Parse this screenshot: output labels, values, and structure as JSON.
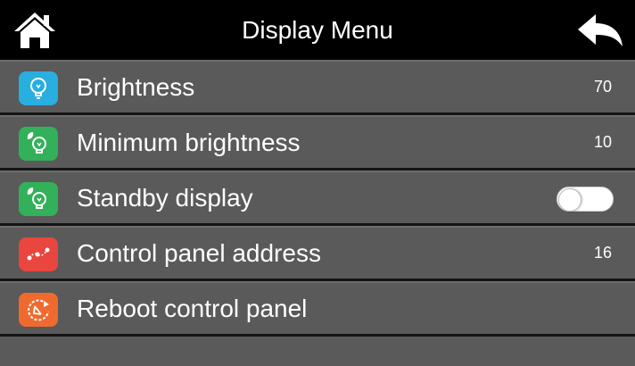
{
  "header": {
    "title": "Display Menu"
  },
  "menu": {
    "items": [
      {
        "label": "Brightness",
        "value": "70",
        "icon": "lightbulb-icon",
        "color": "#29aee0"
      },
      {
        "label": "Minimum brightness",
        "value": "10",
        "icon": "eco-lightbulb-icon",
        "color": "#33b05a"
      },
      {
        "label": "Standby display",
        "toggle": false,
        "icon": "eco-lightbulb-icon",
        "color": "#33b05a"
      },
      {
        "label": "Control panel address",
        "value": "16",
        "icon": "network-route-icon",
        "color": "#e8463e"
      },
      {
        "label": "Reboot control panel",
        "icon": "reboot-icon",
        "color": "#ef6a2e"
      }
    ]
  }
}
